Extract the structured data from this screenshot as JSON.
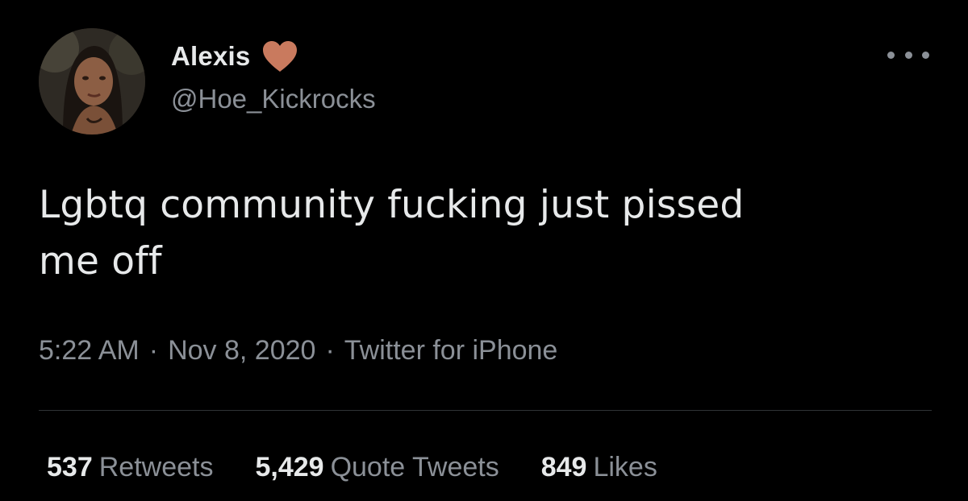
{
  "tweet": {
    "display_name": "Alexis",
    "handle": "@Hoe_Kickrocks",
    "text_line1": "Lgbtq community fucking just pissed",
    "text_line2": "me off",
    "time": "5:22 AM",
    "separator": "·",
    "date": "Nov 8, 2020",
    "source": "Twitter for iPhone"
  },
  "stats": {
    "retweets_count": "537",
    "retweets_label": "Retweets",
    "quotes_count": "5,429",
    "quotes_label": "Quote Tweets",
    "likes_count": "849",
    "likes_label": "Likes"
  },
  "icons": {
    "name_emoji": "heart-icon",
    "menu": "more-options-icon"
  },
  "colors": {
    "background": "#000000",
    "primary_text": "#e7e9ea",
    "secondary_text": "#8b9097",
    "heart": "#c97a5e",
    "divider": "#2f3336"
  }
}
